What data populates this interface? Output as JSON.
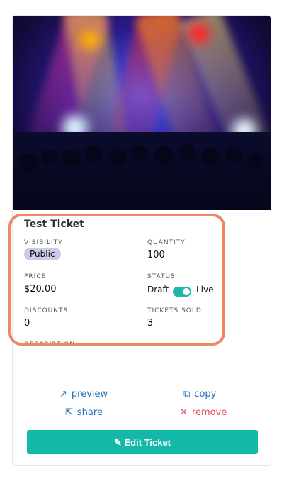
{
  "ticket": {
    "title": "Test Ticket",
    "visibility_label": "VISIBILITY",
    "visibility_value": "Public",
    "quantity_label": "QUANTITY",
    "quantity_value": "100",
    "price_label": "PRICE",
    "price_value": "$20.00",
    "status_label": "STATUS",
    "status_off": "Draft",
    "status_on": "Live",
    "status_is_live": true,
    "discounts_label": "DISCOUNTS",
    "discounts_value": "0",
    "tickets_sold_label": "TICKETS SOLD",
    "tickets_sold_value": "3",
    "description_label": "DESCRIPTION"
  },
  "actions": {
    "preview": "preview",
    "copy": "copy",
    "share": "share",
    "remove": "remove",
    "edit": "Edit Ticket"
  },
  "icons": {
    "preview": "external-link-icon",
    "copy": "copy-icon",
    "share": "share-icon",
    "remove": "close-icon",
    "edit": "pencil-icon"
  },
  "colors": {
    "accent": "#14b8a8",
    "link_blue": "#1f6fb7",
    "remove_red": "#e24b5a",
    "highlight": "#f08763",
    "pill_bg": "#c9cbe8"
  }
}
